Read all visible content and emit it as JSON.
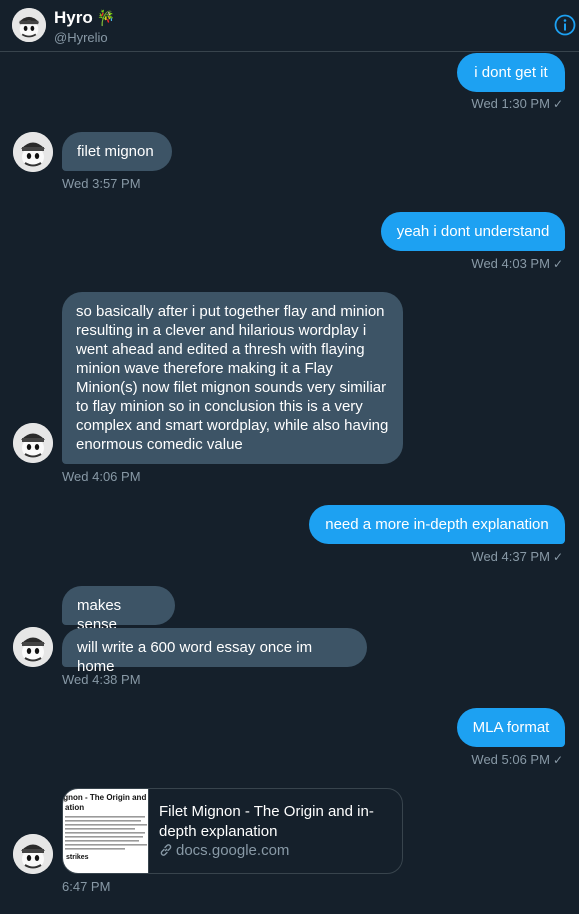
{
  "header": {
    "name": "Hyro",
    "name_emoji": "🎋",
    "handle": "@Hyrelio",
    "info_icon": "info-icon"
  },
  "messages": {
    "m1": {
      "text": "i dont get it",
      "time": "Wed 1:30 PM",
      "status": "✓"
    },
    "m2": {
      "text": "filet mignon",
      "time": "Wed 3:57 PM"
    },
    "m3": {
      "text": "yeah i dont understand",
      "time": "Wed 4:03 PM",
      "status": "✓"
    },
    "m4": {
      "text": "so basically after i put together flay and minion resulting in a clever and hilarious wordplay i went ahead and edited a thresh with flaying minion wave therefore making it a Flay Minion(s) now filet mignon sounds very similiar to flay minion so in conclusion this is a very complex and smart wordplay, while also having enormous comedic value",
      "time": "Wed 4:06 PM"
    },
    "m5": {
      "text": "need a more in-depth explanation",
      "time": "Wed 4:37 PM",
      "status": "✓"
    },
    "m6a": {
      "text": "makes sense"
    },
    "m6b": {
      "text": "will write a 600 word essay once im home",
      "time": "Wed 4:38 PM"
    },
    "m7": {
      "text": "MLA format",
      "time": "Wed 5:06 PM",
      "status": "✓"
    },
    "m8": {
      "card_title": "Filet Mignon - The Origin and in-depth explanation",
      "card_domain": "docs.google.com",
      "thumb_heading": "ignon - The Origin and in-d",
      "thumb_sub": "ation",
      "thumb_footer": "strikes",
      "time": "6:47 PM"
    }
  },
  "colors": {
    "background": "#15202b",
    "outgoing_bubble": "#1da1f2",
    "incoming_bubble": "#3d5466",
    "meta_text": "#8899a6"
  }
}
